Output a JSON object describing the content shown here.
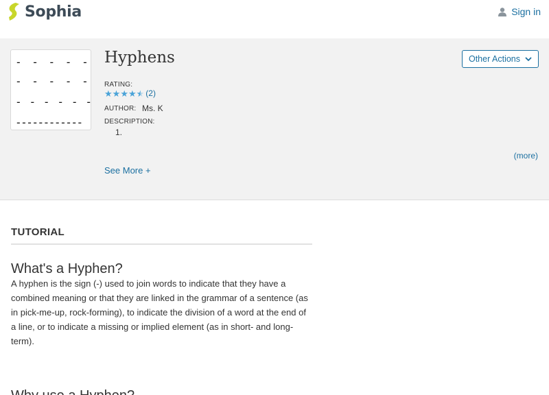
{
  "header": {
    "brand": "Sophia",
    "signin_label": "Sign in",
    "icons": {
      "logo": "sophia-logo-icon",
      "user": "user-icon"
    },
    "colors": {
      "logo": "#c8d62b",
      "link": "#1a6fa0"
    }
  },
  "resource": {
    "thumbnail_rows": [
      "- - - - - -",
      "- - - - - -",
      "- - - - - - -",
      "------------"
    ],
    "title": "Hyphens",
    "rating_label": "RATING:",
    "rating_value": 4.5,
    "rating_count": "(2)",
    "author_label": "AUTHOR:",
    "author": "Ms. K",
    "description_label": "DESCRIPTION:",
    "description": "1.",
    "more_link": "(more)",
    "see_more": "See More +",
    "other_actions": "Other Actions",
    "colors": {
      "panel_bg": "#f2f2f2",
      "star": "#4aa3d8"
    }
  },
  "tutorial": {
    "section_label": "TUTORIAL",
    "heading1": "What's a Hyphen?",
    "paragraph1": "A hyphen is the sign (-) used to join words to indicate that they have a combined meaning or that they are linked in the grammar of a sentence (as in pick-me-up, rock-forming), to indicate the division of a word at the end of a line, or to indicate a missing or implied element (as in short- and long-term).",
    "heading2": "Why use a Hyphen?"
  }
}
